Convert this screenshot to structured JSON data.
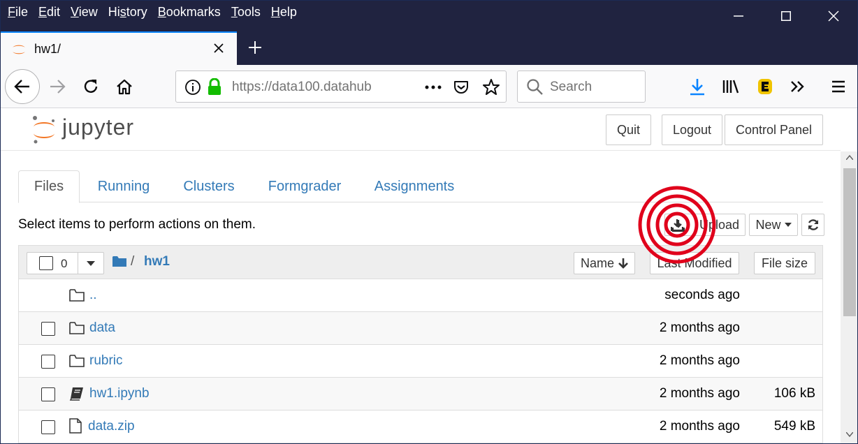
{
  "menu": [
    "File",
    "Edit",
    "View",
    "History",
    "Bookmarks",
    "Tools",
    "Help"
  ],
  "menu_underline": [
    "F",
    "E",
    "V",
    "s",
    "B",
    "T",
    "H"
  ],
  "tab": {
    "title": "hw1/"
  },
  "nav": {
    "url": "https://data100.datahub",
    "search_placeholder": "Search"
  },
  "jupyter": {
    "logo": "jupyter"
  },
  "header_buttons": {
    "quit": "Quit",
    "logout": "Logout",
    "control_panel": "Control Panel"
  },
  "tabs": [
    "Files",
    "Running",
    "Clusters",
    "Formgrader",
    "Assignments"
  ],
  "toolbar": {
    "hint": "Select items to perform actions on them.",
    "upload": "Upload",
    "new": "New"
  },
  "list_header": {
    "selected_count": "0",
    "breadcrumb_sep": "/",
    "folder": "hw1",
    "name_col": "Name",
    "modified_col": "Last Modified",
    "size_col": "File size"
  },
  "files": [
    {
      "name": "..",
      "modified": "seconds ago",
      "size": "",
      "kind": "folder"
    },
    {
      "name": "data",
      "modified": "2 months ago",
      "size": "",
      "kind": "folder"
    },
    {
      "name": "rubric",
      "modified": "2 months ago",
      "size": "",
      "kind": "folder"
    },
    {
      "name": "hw1.ipynb",
      "modified": "2 months ago",
      "size": "106 kB",
      "kind": "notebook"
    },
    {
      "name": "data.zip",
      "modified": "2 months ago",
      "size": "549 kB",
      "kind": "file"
    }
  ],
  "colors": {
    "titlebar": "#202340",
    "link": "#337ab7",
    "download_arrow": "#0a84ff",
    "lock": "#12bc00",
    "annotation": "#e0001b",
    "jupyter_orange": "#f37726"
  }
}
